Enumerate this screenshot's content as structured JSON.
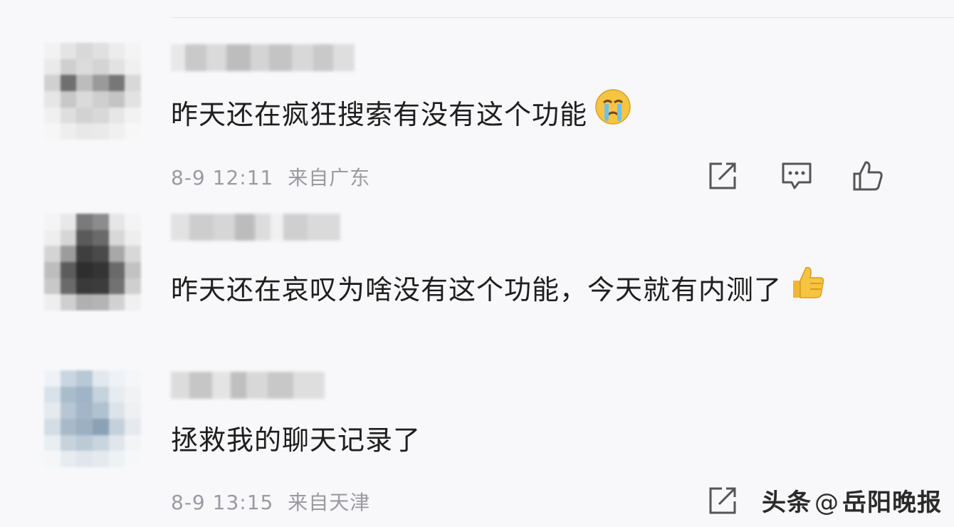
{
  "comments": [
    {
      "text": "昨天还在疯狂搜索有没有这个功能",
      "emoji": "crying-face",
      "time": "8-9 12:11",
      "location": "来自广东",
      "avatar_colors": [
        "#f2f2f2",
        "#e4e4e4",
        "#d8d8d8",
        "#e0e0e0",
        "#ececec",
        "#f4f4f4",
        "#eaeaea",
        "#cfcfcf",
        "#dcdcdc",
        "#d4d4d4",
        "#e2e2e2",
        "#f0f0f0",
        "#d0d0d0",
        "#6f6f6f",
        "#bcbcbc",
        "#9a9a9a",
        "#777777",
        "#d8d8d8",
        "#e6e6e6",
        "#c8c8c8",
        "#dadada",
        "#cfcfcf",
        "#c4c4c4",
        "#e2e2e2",
        "#f0f0f0",
        "#dedede",
        "#d2d2d2",
        "#d8d8d8",
        "#e6e6e6",
        "#f2f2f2",
        "#f6f6f6",
        "#eeeeee",
        "#e8e8e8",
        "#eaeaea",
        "#f0f0f0",
        "#f7f7f7"
      ]
    },
    {
      "text": "昨天还在哀叹为啥没有这个功能，今天就有内测了",
      "emoji": "thumbs-up",
      "avatar_colors": [
        "#f4f4f4",
        "#e8e8e8",
        "#7a7a7a",
        "#8c8c8c",
        "#e6e6e6",
        "#f4f4f4",
        "#eeeeee",
        "#d6d6d6",
        "#5a5a5a",
        "#6a6a6a",
        "#d8d8d8",
        "#eeeeee",
        "#d4d4d4",
        "#9c9c9c",
        "#3f3f3f",
        "#4a4a4a",
        "#a8a8a8",
        "#d8d8d8",
        "#bdbdbd",
        "#5c5c5c",
        "#2e2e2e",
        "#343434",
        "#6a6a6a",
        "#c2c2c2",
        "#c8c8c8",
        "#6a6a6a",
        "#3a3a3a",
        "#3c3c3c",
        "#727272",
        "#cfcfcf",
        "#eeeeee",
        "#cfcfcf",
        "#b0b0b0",
        "#b4b4b4",
        "#d2d2d2",
        "#f0f0f0"
      ]
    },
    {
      "text": "拯救我的聊天记录了",
      "time": "8-9 13:15",
      "location": "来自天津",
      "avatar_colors": [
        "#eef2f6",
        "#c9d6e2",
        "#b9c8d6",
        "#e2e8ee",
        "#eef2f6",
        "#f4f6f8",
        "#d8e2ea",
        "#a9bccc",
        "#9fb4c6",
        "#c6d2dc",
        "#e6ecf0",
        "#f0f2f4",
        "#e4eaee",
        "#b7c6d2",
        "#a2b6c8",
        "#b0c2d0",
        "#dce4ea",
        "#eef0f2",
        "#d2dde6",
        "#a8bac9",
        "#9cb0c2",
        "#8aa1b6",
        "#c4d0da",
        "#e6eaee",
        "#e8eef2",
        "#c6d2dc",
        "#bccad6",
        "#c8d4de",
        "#e0e6ec",
        "#f2f4f6",
        "#f4f6f8",
        "#e8ecf0",
        "#e0e6ec",
        "#e4eaee",
        "#eef2f4",
        "#f6f7f8"
      ]
    }
  ],
  "watermark": {
    "prefix": "头条",
    "at": "@",
    "account": "岳阳晚报"
  }
}
